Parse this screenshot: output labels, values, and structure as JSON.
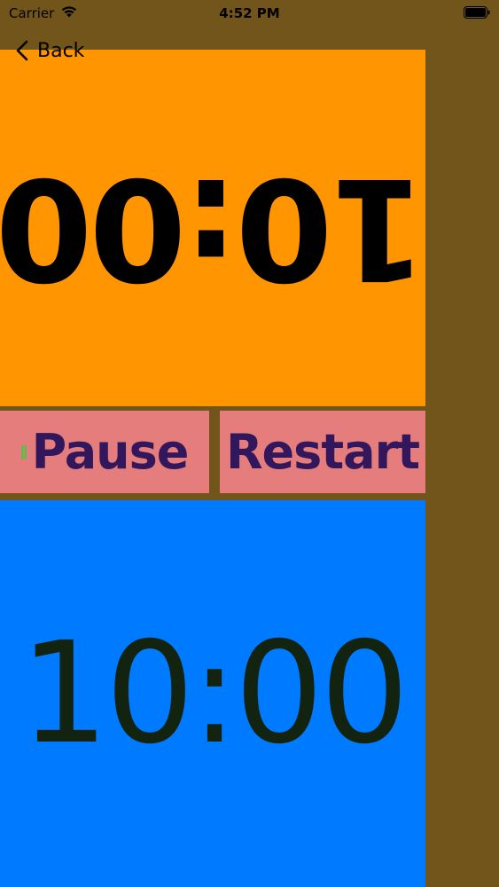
{
  "status_bar": {
    "carrier": "Carrier",
    "time": "4:52 PM",
    "wifi_icon": "wifi-icon",
    "battery_icon": "battery-icon"
  },
  "nav": {
    "back_label": "Back",
    "back_icon": "chevron-left-icon"
  },
  "timers": {
    "top": {
      "value": "10:00",
      "flipped": true
    },
    "bottom": {
      "value": "10:00"
    }
  },
  "controls": {
    "pause_label": "Pause",
    "restart_label": "Restart",
    "pause_mark_icon": "pause-icon"
  },
  "colors": {
    "background": "#72551a",
    "top_timer": "#ff9500",
    "bottom_timer": "#007aff",
    "button_bg": "#e57d7d",
    "button_text": "#33175c",
    "pause_mark": "#63b94a"
  }
}
